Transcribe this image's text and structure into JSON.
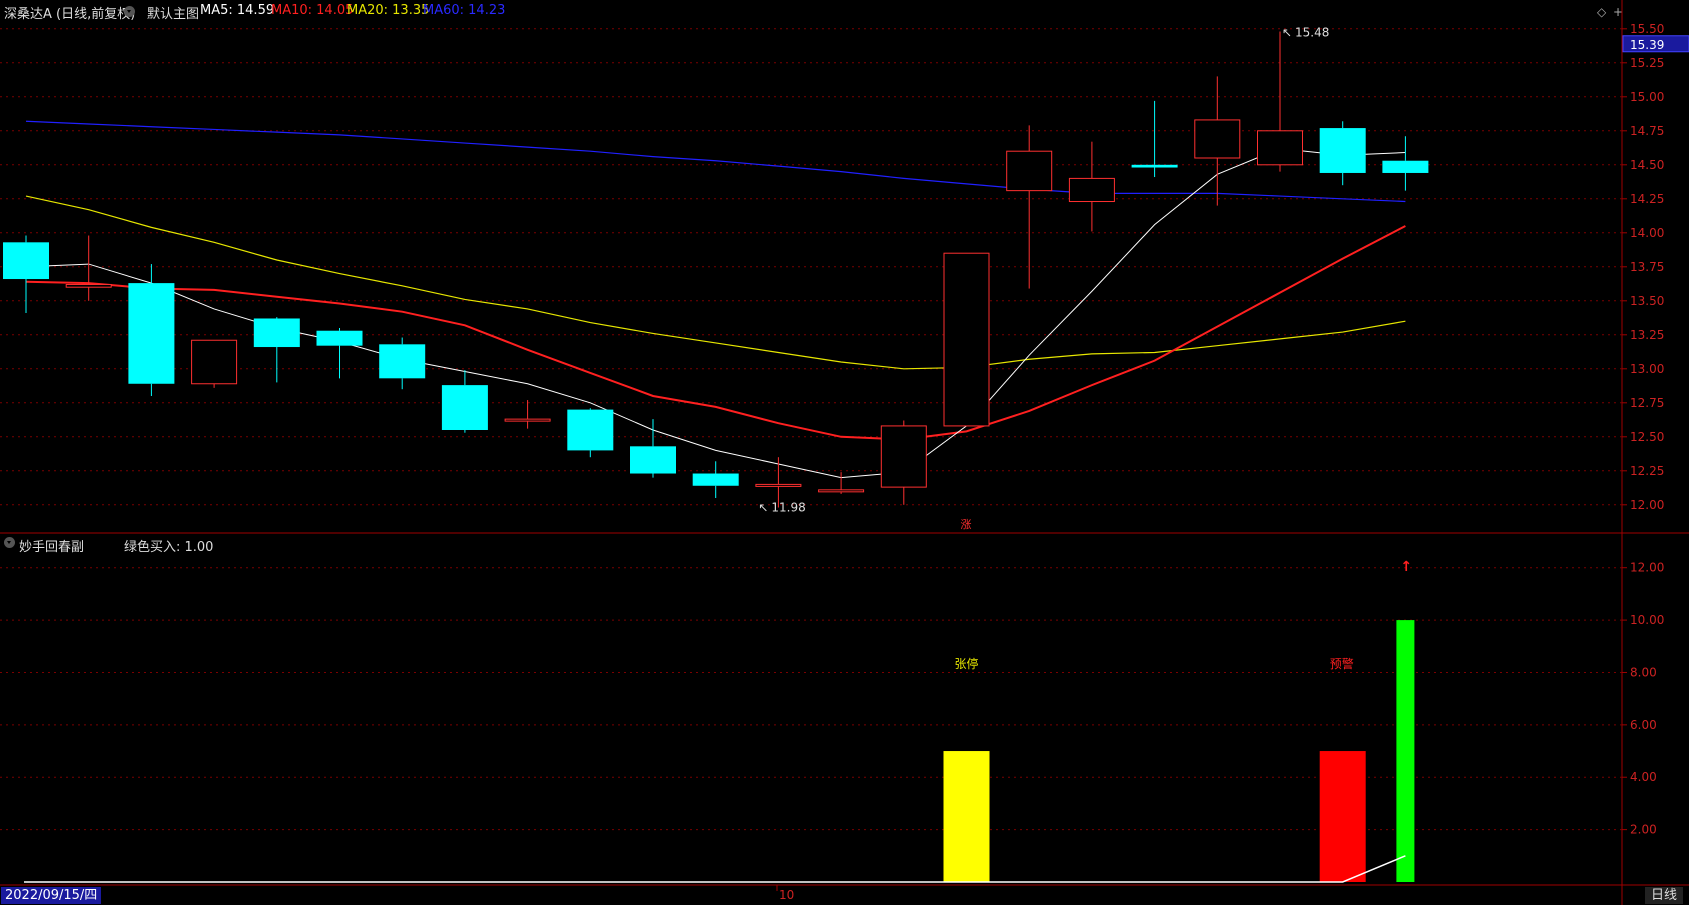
{
  "header": {
    "stock_name": "深桑达A (日线,前复权)",
    "main_chart_label": "默认主图",
    "ma5": "MA5: 14.59",
    "ma10": "MA10: 14.05",
    "ma20": "MA20: 13.35",
    "ma60": "MA60: 14.23",
    "current_price": "15.39",
    "colors": {
      "ma5": "#ffffff",
      "ma10": "#ff2020",
      "ma20": "#e6e600",
      "ma60": "#2020ff"
    }
  },
  "indicator": {
    "name": "妙手回春副",
    "value_label": "绿色买入: 1.00",
    "signal_zhangting": "张停",
    "signal_yujing": "预警"
  },
  "footer": {
    "date": "2022/09/15/四",
    "x_tick": "10",
    "timeframe": "日线"
  },
  "chart_data": [
    {
      "type": "candlestick",
      "ylim": [
        11.8,
        15.55
      ],
      "y_ticks": [
        "15.50",
        "15.25",
        "15.00",
        "14.75",
        "14.50",
        "14.25",
        "14.00",
        "13.75",
        "13.50",
        "13.25",
        "13.00",
        "12.75",
        "12.50",
        "12.25",
        "12.00"
      ],
      "y_tick_values": [
        15.5,
        15.25,
        15.0,
        14.75,
        14.5,
        14.25,
        14.0,
        13.75,
        13.5,
        13.25,
        13.0,
        12.75,
        12.5,
        12.25,
        12.0
      ],
      "candles": [
        {
          "o": 13.93,
          "h": 13.98,
          "l": 13.41,
          "c": 13.66
        },
        {
          "o": 13.6,
          "h": 13.98,
          "l": 13.5,
          "c": 13.62
        },
        {
          "o": 13.63,
          "h": 13.77,
          "l": 12.8,
          "c": 12.89
        },
        {
          "o": 12.89,
          "h": 13.21,
          "l": 12.86,
          "c": 13.21
        },
        {
          "o": 13.37,
          "h": 13.38,
          "l": 12.9,
          "c": 13.16
        },
        {
          "o": 13.28,
          "h": 13.3,
          "l": 12.93,
          "c": 13.17
        },
        {
          "o": 13.18,
          "h": 13.23,
          "l": 12.85,
          "c": 12.93
        },
        {
          "o": 12.88,
          "h": 12.99,
          "l": 12.53,
          "c": 12.55
        },
        {
          "o": 12.63,
          "h": 12.77,
          "l": 12.56,
          "c": 12.63
        },
        {
          "o": 12.7,
          "h": 12.71,
          "l": 12.35,
          "c": 12.4
        },
        {
          "o": 12.43,
          "h": 12.63,
          "l": 12.2,
          "c": 12.23
        },
        {
          "o": 12.23,
          "h": 12.32,
          "l": 12.05,
          "c": 12.14
        },
        {
          "o": 12.15,
          "h": 12.35,
          "l": 11.98,
          "c": 12.15
        },
        {
          "o": 12.1,
          "h": 12.24,
          "l": 12.08,
          "c": 12.11
        },
        {
          "o": 12.13,
          "h": 12.62,
          "l": 12.0,
          "c": 12.58
        },
        {
          "o": 12.58,
          "h": 13.85,
          "l": 12.58,
          "c": 13.85
        },
        {
          "o": 14.31,
          "h": 14.79,
          "l": 13.59,
          "c": 14.6
        },
        {
          "o": 14.23,
          "h": 14.67,
          "l": 14.01,
          "c": 14.4
        },
        {
          "o": 14.5,
          "h": 14.97,
          "l": 14.41,
          "c": 14.48
        },
        {
          "o": 14.55,
          "h": 15.15,
          "l": 14.2,
          "c": 14.83
        },
        {
          "o": 14.5,
          "h": 15.48,
          "l": 14.45,
          "c": 14.75
        },
        {
          "o": 14.77,
          "h": 14.82,
          "l": 14.35,
          "c": 14.44
        },
        {
          "o": 14.53,
          "h": 14.71,
          "l": 14.31,
          "c": 14.44
        }
      ],
      "ma5": [
        13.75,
        13.77,
        13.63,
        13.44,
        13.3,
        13.2,
        13.07,
        12.98,
        12.89,
        12.75,
        12.55,
        12.4,
        12.3,
        12.2,
        12.24,
        12.58,
        13.1,
        13.57,
        14.06,
        14.43,
        14.62,
        14.57,
        14.59
      ],
      "ma10": [
        13.64,
        13.63,
        13.59,
        13.58,
        13.53,
        13.48,
        13.42,
        13.32,
        13.14,
        12.97,
        12.8,
        12.72,
        12.6,
        12.5,
        12.48,
        12.54,
        12.69,
        12.88,
        13.06,
        13.31,
        13.56,
        13.81,
        14.05
      ],
      "ma20": [
        14.27,
        14.17,
        14.04,
        13.93,
        13.8,
        13.7,
        13.61,
        13.51,
        13.44,
        13.34,
        13.26,
        13.19,
        13.12,
        13.05,
        13.0,
        13.01,
        13.07,
        13.11,
        13.12,
        13.17,
        13.22,
        13.27,
        13.35
      ],
      "ma60": [
        14.82,
        14.8,
        14.78,
        14.76,
        14.74,
        14.72,
        14.69,
        14.66,
        14.63,
        14.6,
        14.56,
        14.53,
        14.49,
        14.45,
        14.4,
        14.36,
        14.32,
        14.29,
        14.29,
        14.29,
        14.27,
        14.25,
        14.23
      ],
      "high_annotation": {
        "index": 20,
        "value": 15.48,
        "label": "15.48"
      },
      "low_annotation": {
        "index": 12,
        "value": 11.98,
        "label": "11.98"
      },
      "limit_up_marker": {
        "index": 15,
        "label": "涨"
      }
    },
    {
      "type": "bar",
      "ylim": [
        0,
        12.6
      ],
      "y_ticks": [
        "12.00",
        "10.00",
        "8.00",
        "6.00",
        "4.00",
        "2.00"
      ],
      "y_tick_values": [
        12,
        10,
        8,
        6,
        4,
        2
      ],
      "bars": [
        {
          "index": 15,
          "value": 5.0,
          "color": "#ffff00"
        },
        {
          "index": 21,
          "value": 5.0,
          "color": "#ff0000"
        },
        {
          "index": 22,
          "value": 10.0,
          "color": "#00ff00"
        }
      ],
      "line": [
        0,
        0,
        0,
        0,
        0,
        0,
        0,
        0,
        0,
        0,
        0,
        0,
        0,
        0,
        0,
        0,
        0,
        0,
        0,
        0,
        0,
        0,
        1.0
      ],
      "buy_arrow_index": 22
    }
  ]
}
